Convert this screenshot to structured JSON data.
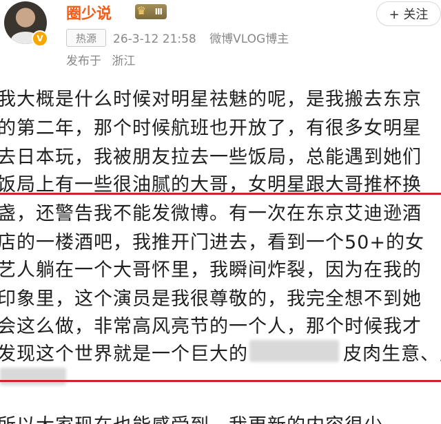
{
  "user": {
    "name": "圈少说",
    "level_badge": "Ⅲ",
    "verified": "V",
    "follow_label": "+ 关注"
  },
  "meta": {
    "hot_tag": "热源",
    "datetime": "26-3-12 21:58",
    "source": "微博VLOG博主",
    "location_prefix": "发布于",
    "location": "浙江"
  },
  "post": {
    "lines": [
      "我大概是什么时候对明星祛魅的呢，是我搬去东京",
      "的第二年，那个时候航班也开放了，有很多女明星",
      "去日本玩，我被朋友拉去一些饭局，总能遇到她们",
      "饭局上有一些很油腻的大哥，女明星跟大哥推杯换",
      "盏，还警告我不能发微博。有一次在东京艾迪逊酒",
      "店的一楼酒吧，我推开门进去，看到一个50+的女",
      "艺人躺在一个大哥怀里，我瞬间炸裂，因为在我的",
      "印象里，这个演员是我很尊敬的，我完全想不到她",
      "会这么做，非常高风亮节的一个人，那个时候我才",
      "发现这个世界就是一个巨大的",
      "，",
      "所以大家现在也能感受到，我更新的内容很少，"
    ],
    "line10_tail_a": "皮肉生意、风",
    "accent_color": "#d4202c"
  }
}
